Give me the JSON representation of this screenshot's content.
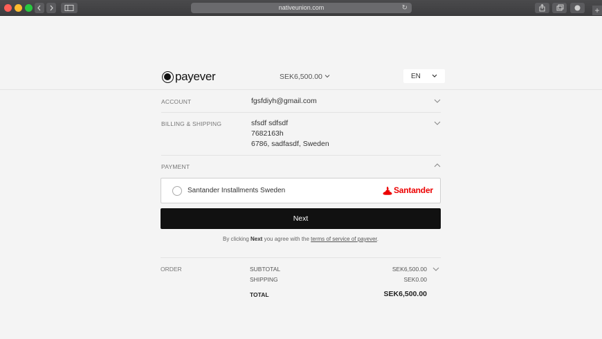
{
  "browser": {
    "url": "nativeunion.com",
    "reload_icon": "reload-icon",
    "plus": "+"
  },
  "header": {
    "brand": "payever",
    "amount": "SEK6,500.00",
    "language": "EN"
  },
  "account": {
    "label": "ACCOUNT",
    "email": "fgsfdiyh@gmail.com"
  },
  "billing": {
    "label": "BILLING & SHIPPING",
    "name": "sfsdf sdfsdf",
    "phone": "7682163h",
    "address": "6786, sadfasdf, Sweden"
  },
  "payment": {
    "label": "PAYMENT",
    "option_name": "Santander Installments Sweden",
    "provider_logo_text": "Santander"
  },
  "next_label": "Next",
  "terms": {
    "prefix": "By clicking ",
    "bold": "Next",
    "middle": " you agree with the ",
    "link": "terms of service of payever",
    "suffix": "."
  },
  "order": {
    "label": "ORDER",
    "subtotal_label": "SUBTOTAL",
    "subtotal_value": "SEK6,500.00",
    "shipping_label": "SHIPPING",
    "shipping_value": "SEK0.00",
    "total_label": "TOTAL",
    "total_value": "SEK6,500.00"
  },
  "colors": {
    "accent": "#111111",
    "brand_red": "#ec0000"
  }
}
